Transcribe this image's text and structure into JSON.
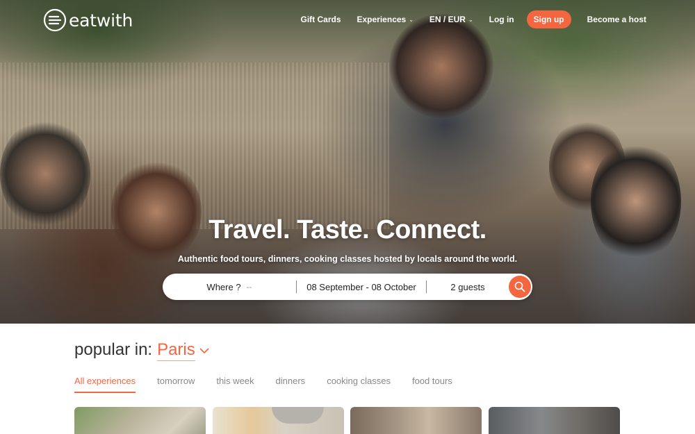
{
  "brand": {
    "name": "eatwith"
  },
  "nav": {
    "gift_cards": "Gift Cards",
    "experiences": "Experiences",
    "locale": "EN / EUR",
    "login": "Log in",
    "signup": "Sign up",
    "become_host": "Become a host"
  },
  "hero": {
    "headline": "Travel. Taste. Connect.",
    "subline": "Authentic food tours, dinners, cooking classes hosted by locals around the world."
  },
  "search": {
    "where_label": "Where ?",
    "where_placeholder": "--",
    "dates": "08 September - 08 October",
    "guests": "2 guests"
  },
  "popular": {
    "label": "popular in:",
    "city": "Paris"
  },
  "tabs": [
    {
      "label": "All experiences",
      "active": true
    },
    {
      "label": "tomorrow",
      "active": false
    },
    {
      "label": "this week",
      "active": false
    },
    {
      "label": "dinners",
      "active": false
    },
    {
      "label": "cooking classes",
      "active": false
    },
    {
      "label": "food tours",
      "active": false
    }
  ],
  "colors": {
    "accent": "#f3663f"
  },
  "icons": {
    "logo": "eatwith-logo-icon",
    "search": "search-icon",
    "chevron": "chevron-down-icon"
  }
}
